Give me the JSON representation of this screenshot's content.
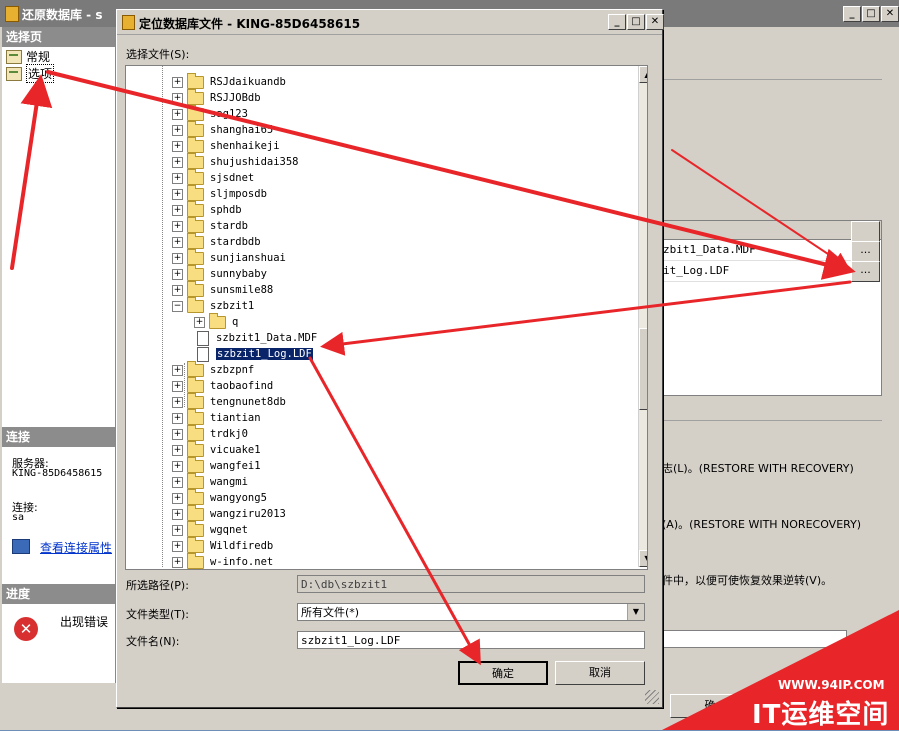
{
  "bg_window": {
    "title": "还原数据库 - s",
    "left_panel": {
      "select_page_header": "选择页",
      "pages": [
        "常规",
        "选项"
      ],
      "connection_header": "连接",
      "server_label": "服务器:",
      "server_value": "KING-85D6458615",
      "conn_label": "连接:",
      "conn_value": "sa",
      "view_props_link": "查看连接属性",
      "progress_header": "进度",
      "progress_status": "出现错误"
    },
    "right_panel": {
      "rows": [
        "zbit1_Data.MDF",
        "it_Log.LDF"
      ],
      "ellipsis": "...",
      "opt_recovery": "志(L)。(RESTORE WITH RECOVERY)",
      "opt_norecovery": "(A)。(RESTORE WITH NORECOVERY)",
      "opt_standby": "件中，以便可使恢复效果逆转(V)。",
      "partial_button": "确"
    }
  },
  "dialog": {
    "title": "定位数据库文件 - KING-85D6458615",
    "tree_label": "选择文件(S):",
    "tree_items": [
      {
        "label": "RSJdaikuandb",
        "kind": "folder",
        "level": 0
      },
      {
        "label": "RSJJOBdb",
        "kind": "folder",
        "level": 0
      },
      {
        "label": "sag123",
        "kind": "folder",
        "level": 0
      },
      {
        "label": "shanghai65",
        "kind": "folder",
        "level": 0
      },
      {
        "label": "shenhaikeji",
        "kind": "folder",
        "level": 0
      },
      {
        "label": "shujushidai358",
        "kind": "folder",
        "level": 0
      },
      {
        "label": "sjsdnet",
        "kind": "folder",
        "level": 0
      },
      {
        "label": "sljmposdb",
        "kind": "folder",
        "level": 0
      },
      {
        "label": "sphdb",
        "kind": "folder",
        "level": 0
      },
      {
        "label": "stardb",
        "kind": "folder",
        "level": 0
      },
      {
        "label": "stardbdb",
        "kind": "folder",
        "level": 0
      },
      {
        "label": "sunjianshuai",
        "kind": "folder",
        "level": 0
      },
      {
        "label": "sunnybaby",
        "kind": "folder",
        "level": 0
      },
      {
        "label": "sunsmile88",
        "kind": "folder",
        "level": 0
      },
      {
        "label": "szbzit1",
        "kind": "folder-open",
        "level": 0
      },
      {
        "label": "q",
        "kind": "folder",
        "level": 1
      },
      {
        "label": "szbzit1_Data.MDF",
        "kind": "file",
        "level": 1
      },
      {
        "label": "szbzit1_Log.LDF",
        "kind": "file",
        "level": 1,
        "selected": true
      },
      {
        "label": "szbzpnf",
        "kind": "folder",
        "level": 0
      },
      {
        "label": "taobaofind",
        "kind": "folder",
        "level": 0
      },
      {
        "label": "tengnunet8db",
        "kind": "folder",
        "level": 0
      },
      {
        "label": "tiantian",
        "kind": "folder",
        "level": 0
      },
      {
        "label": "trdkj0",
        "kind": "folder",
        "level": 0
      },
      {
        "label": "vicuake1",
        "kind": "folder",
        "level": 0
      },
      {
        "label": "wangfei1",
        "kind": "folder",
        "level": 0
      },
      {
        "label": "wangmi",
        "kind": "folder",
        "level": 0
      },
      {
        "label": "wangyong5",
        "kind": "folder",
        "level": 0
      },
      {
        "label": "wangziru2013",
        "kind": "folder",
        "level": 0
      },
      {
        "label": "wgqnet",
        "kind": "folder",
        "level": 0
      },
      {
        "label": "Wildfiredb",
        "kind": "folder",
        "level": 0
      },
      {
        "label": "w-info.net",
        "kind": "folder",
        "level": 0
      }
    ],
    "path_label": "所选路径(P):",
    "path_value": "D:\\db\\szbzit1",
    "type_label": "文件类型(T):",
    "type_value": "所有文件(*)",
    "name_label": "文件名(N):",
    "name_value": "szbzit1_Log.LDF",
    "ok_label": "确定",
    "cancel_label": "取消"
  },
  "watermark": {
    "url": "WWW.94IP.COM",
    "text": "IT运维空间"
  },
  "colors": {
    "annotation": "#e8262a",
    "selection": "#0a246a",
    "watermark": "#e8262a"
  }
}
